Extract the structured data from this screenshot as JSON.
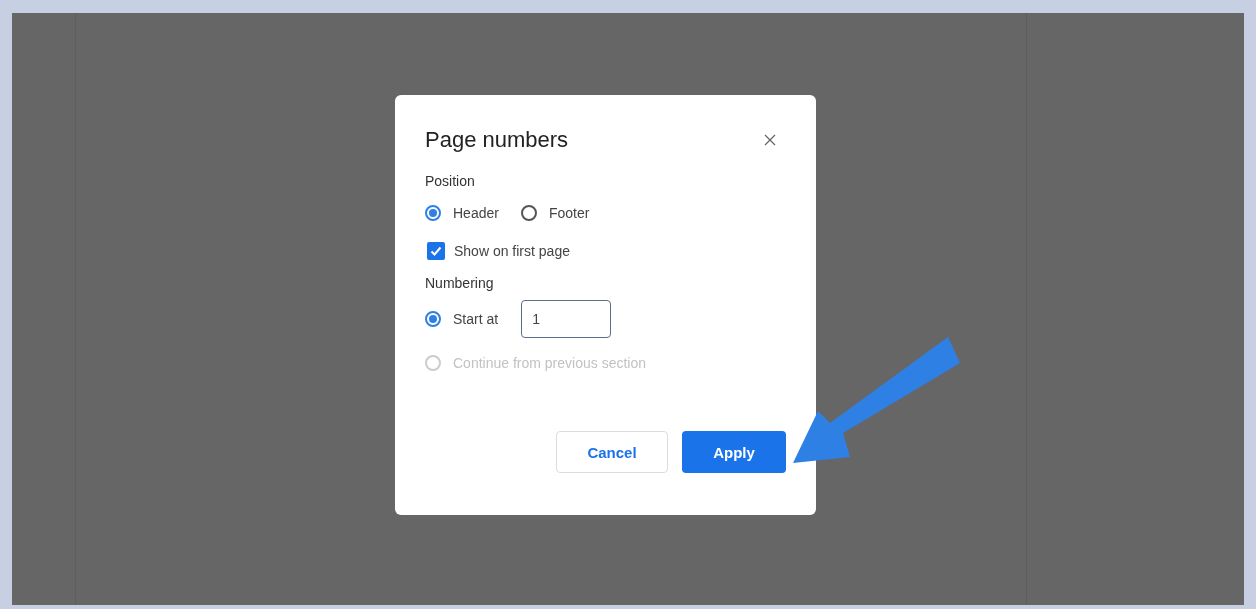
{
  "dialog": {
    "title": "Page numbers",
    "position": {
      "label": "Position",
      "options": [
        {
          "label": "Header",
          "selected": true
        },
        {
          "label": "Footer",
          "selected": false
        }
      ]
    },
    "first_page": {
      "label": "Show on first page",
      "checked": true
    },
    "numbering": {
      "label": "Numbering",
      "options": [
        {
          "kind": "field",
          "label": "Start at",
          "selected": true,
          "disabled": false,
          "value": "1"
        },
        {
          "kind": "plain",
          "label": "Continue from previous section",
          "selected": false,
          "disabled": true
        }
      ]
    },
    "buttons": [
      {
        "kind": "secondary",
        "label": "Cancel"
      },
      {
        "kind": "primary",
        "label": "Apply"
      }
    ]
  }
}
